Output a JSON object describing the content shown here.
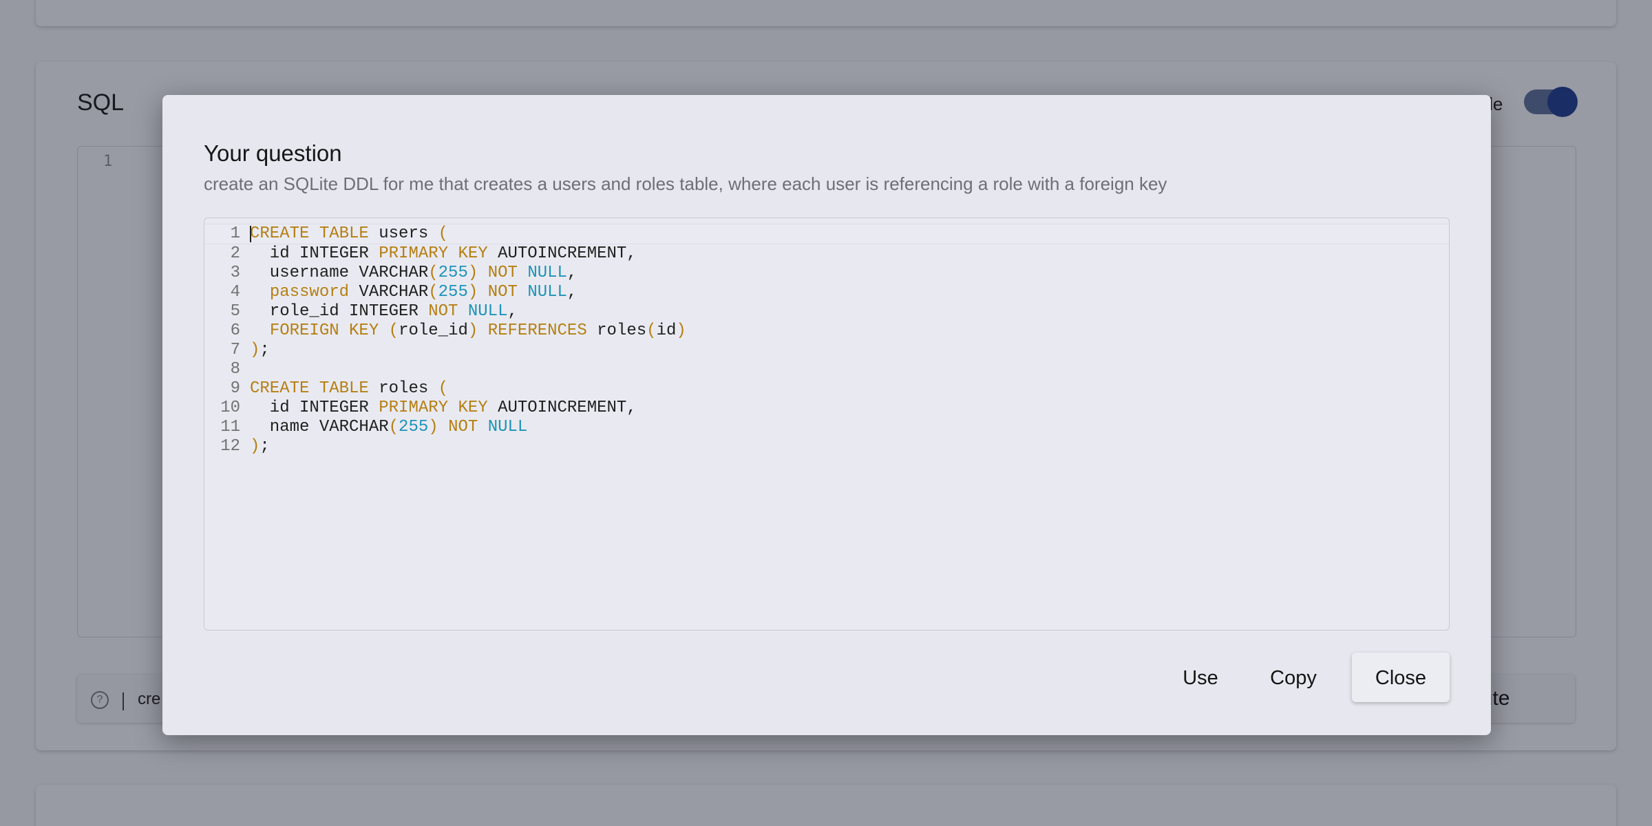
{
  "background": {
    "sql_title": "SQL",
    "mode_label_fragment": "ode",
    "editor_line": "1",
    "input_fragment": "cre",
    "execute_fragment": "ecute",
    "help_icon_glyph": "?"
  },
  "modal": {
    "title": "Your question",
    "question": "create an SQLite DDL for me that creates a users and roles table, where each user is referencing a role with a foreign key",
    "buttons": {
      "use": "Use",
      "copy": "Copy",
      "close": "Close"
    },
    "code_lines": [
      {
        "n": "1",
        "tokens": [
          {
            "t": "CREATE TABLE",
            "c": "kw"
          },
          {
            "t": " users ",
            "c": "txt"
          },
          {
            "t": "(",
            "c": "br"
          }
        ]
      },
      {
        "n": "2",
        "tokens": [
          {
            "t": "  id INTEGER ",
            "c": "txt"
          },
          {
            "t": "PRIMARY KEY",
            "c": "kw"
          },
          {
            "t": " AUTOINCREMENT,",
            "c": "txt"
          }
        ]
      },
      {
        "n": "3",
        "tokens": [
          {
            "t": "  username VARCHAR",
            "c": "txt"
          },
          {
            "t": "(",
            "c": "br"
          },
          {
            "t": "255",
            "c": "num"
          },
          {
            "t": ")",
            "c": "br"
          },
          {
            "t": " ",
            "c": "txt"
          },
          {
            "t": "NOT",
            "c": "kw"
          },
          {
            "t": " ",
            "c": "txt"
          },
          {
            "t": "NULL",
            "c": "num"
          },
          {
            "t": ",",
            "c": "txt"
          }
        ]
      },
      {
        "n": "4",
        "tokens": [
          {
            "t": "  ",
            "c": "txt"
          },
          {
            "t": "password",
            "c": "kw"
          },
          {
            "t": " VARCHAR",
            "c": "txt"
          },
          {
            "t": "(",
            "c": "br"
          },
          {
            "t": "255",
            "c": "num"
          },
          {
            "t": ")",
            "c": "br"
          },
          {
            "t": " ",
            "c": "txt"
          },
          {
            "t": "NOT",
            "c": "kw"
          },
          {
            "t": " ",
            "c": "txt"
          },
          {
            "t": "NULL",
            "c": "num"
          },
          {
            "t": ",",
            "c": "txt"
          }
        ]
      },
      {
        "n": "5",
        "tokens": [
          {
            "t": "  role_id INTEGER ",
            "c": "txt"
          },
          {
            "t": "NOT",
            "c": "kw"
          },
          {
            "t": " ",
            "c": "txt"
          },
          {
            "t": "NULL",
            "c": "num"
          },
          {
            "t": ",",
            "c": "txt"
          }
        ]
      },
      {
        "n": "6",
        "tokens": [
          {
            "t": "  ",
            "c": "txt"
          },
          {
            "t": "FOREIGN KEY",
            "c": "kw"
          },
          {
            "t": " ",
            "c": "txt"
          },
          {
            "t": "(",
            "c": "br"
          },
          {
            "t": "role_id",
            "c": "txt"
          },
          {
            "t": ")",
            "c": "br"
          },
          {
            "t": " ",
            "c": "txt"
          },
          {
            "t": "REFERENCES",
            "c": "kw"
          },
          {
            "t": " roles",
            "c": "txt"
          },
          {
            "t": "(",
            "c": "br"
          },
          {
            "t": "id",
            "c": "txt"
          },
          {
            "t": ")",
            "c": "br"
          }
        ]
      },
      {
        "n": "7",
        "tokens": [
          {
            "t": ")",
            "c": "br"
          },
          {
            "t": ";",
            "c": "txt"
          }
        ]
      },
      {
        "n": "8",
        "tokens": []
      },
      {
        "n": "9",
        "tokens": [
          {
            "t": "CREATE TABLE",
            "c": "kw"
          },
          {
            "t": " roles ",
            "c": "txt"
          },
          {
            "t": "(",
            "c": "br"
          }
        ]
      },
      {
        "n": "10",
        "tokens": [
          {
            "t": "  id INTEGER ",
            "c": "txt"
          },
          {
            "t": "PRIMARY KEY",
            "c": "kw"
          },
          {
            "t": " AUTOINCREMENT,",
            "c": "txt"
          }
        ]
      },
      {
        "n": "11",
        "tokens": [
          {
            "t": "  name VARCHAR",
            "c": "txt"
          },
          {
            "t": "(",
            "c": "br"
          },
          {
            "t": "255",
            "c": "num"
          },
          {
            "t": ")",
            "c": "br"
          },
          {
            "t": " ",
            "c": "txt"
          },
          {
            "t": "NOT",
            "c": "kw"
          },
          {
            "t": " ",
            "c": "txt"
          },
          {
            "t": "NULL",
            "c": "num"
          }
        ]
      },
      {
        "n": "12",
        "tokens": [
          {
            "t": ")",
            "c": "br"
          },
          {
            "t": ";",
            "c": "txt"
          }
        ]
      }
    ]
  },
  "colors": {
    "keyword": "#b57f13",
    "number_null": "#1e93b8",
    "toggle_knob": "#1d3c8c"
  }
}
